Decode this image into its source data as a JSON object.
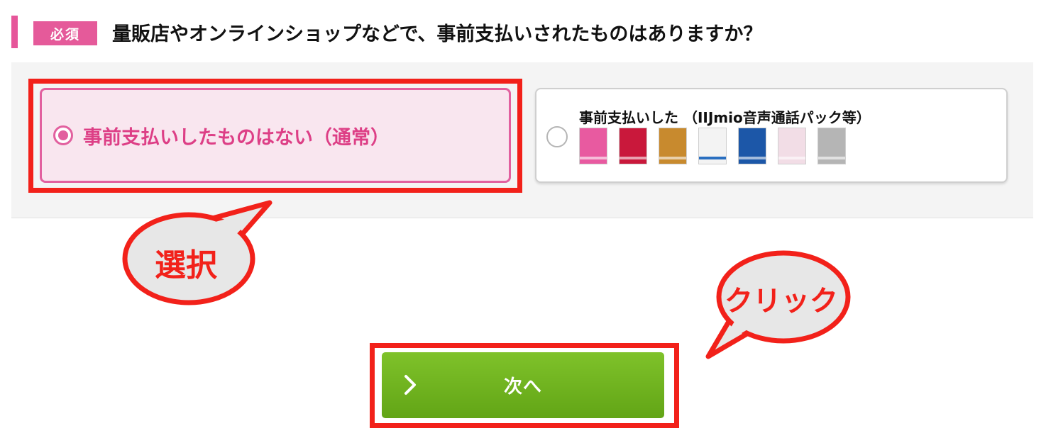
{
  "question": {
    "required_badge": "必須",
    "text": "量販店やオンラインショップなどで、事前支払いされたものはありますか？"
  },
  "options": [
    {
      "label": "事前支払いしたものはない（通常）",
      "selected": true
    },
    {
      "label": "事前支払いした （IIJmio音声通話パック等）",
      "selected": false
    }
  ],
  "pack_thumbnails": [
    {
      "color": "#e85aa0",
      "icon": "package-thumbnail-pink"
    },
    {
      "color": "#c9183b",
      "icon": "package-thumbnail-red"
    },
    {
      "color": "#c88a2e",
      "icon": "package-thumbnail-gold"
    },
    {
      "color": "#f3f3f3",
      "icon": "package-thumbnail-white"
    },
    {
      "color": "#1c57a8",
      "icon": "package-thumbnail-blue"
    },
    {
      "color": "#f2dde6",
      "icon": "package-thumbnail-light-pink"
    },
    {
      "color": "#b5b5b5",
      "icon": "package-thumbnail-gray"
    }
  ],
  "annotations": {
    "select_label": "選択",
    "click_label": "クリック",
    "highlight_color": "#f2211a"
  },
  "next_button": {
    "label": "次へ",
    "icon": "chevron-right-icon"
  },
  "colors": {
    "accent_pink": "#e2609f",
    "button_green": "#6cb11f"
  }
}
